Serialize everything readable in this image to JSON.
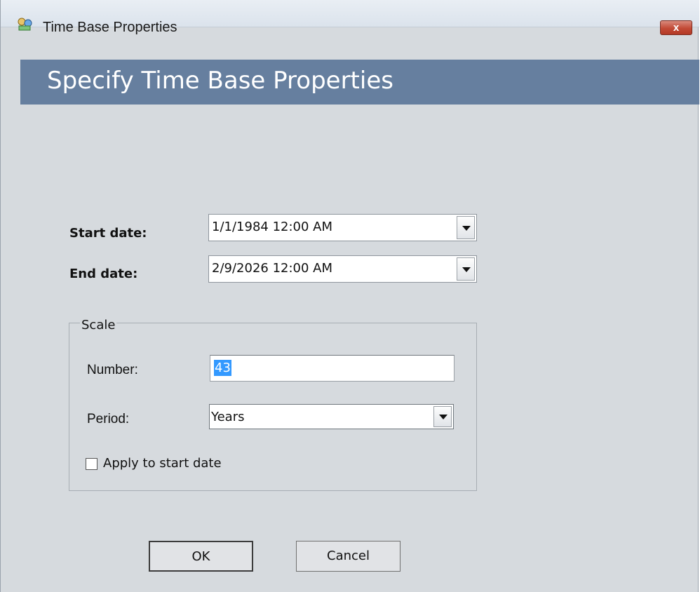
{
  "window": {
    "title": "Time Base Properties",
    "close_label": "x",
    "icon": "time-base-icon"
  },
  "header": {
    "title": "Specify Time Base Properties"
  },
  "form": {
    "start_date": {
      "label": "Start date:",
      "value": "1/1/1984 12:00 AM"
    },
    "end_date": {
      "label": "End date:",
      "value": "2/9/2026 12:00 AM"
    }
  },
  "scale": {
    "legend": "Scale",
    "number": {
      "label": "Number:",
      "value": "43"
    },
    "period": {
      "label": "Period:",
      "value": "Years"
    },
    "apply_checkbox": {
      "label": "Apply to start date",
      "checked": false
    }
  },
  "buttons": {
    "ok": "OK",
    "cancel": "Cancel"
  },
  "colors": {
    "header_bg": "#667f9f",
    "window_bg": "#d6dade",
    "selection": "#3399ff",
    "close_btn": "#c24a36"
  }
}
